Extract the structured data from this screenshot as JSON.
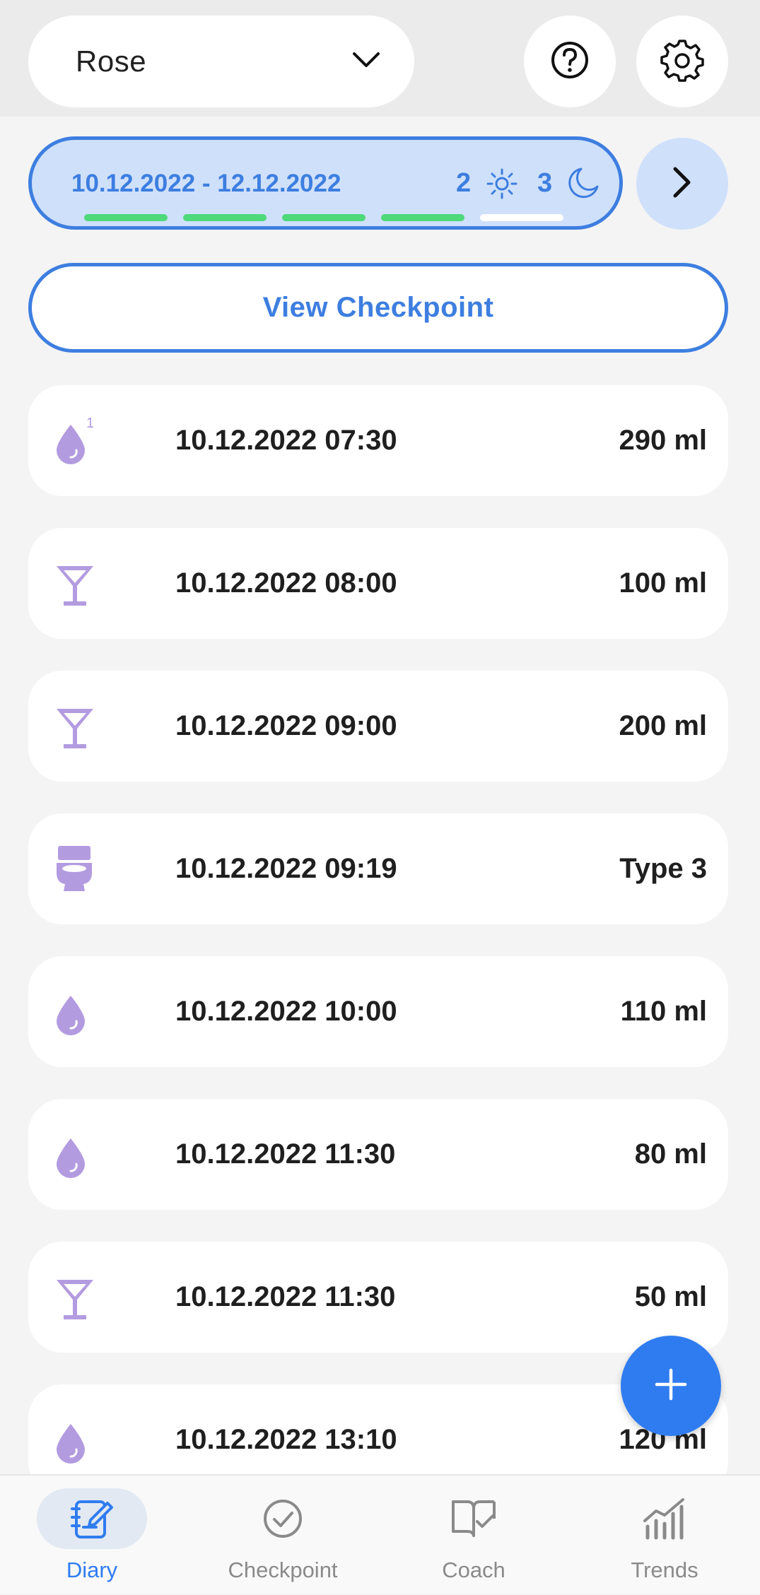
{
  "header": {
    "selected_item": "Rose",
    "help_icon": "help-circle-icon",
    "settings_icon": "gear-icon"
  },
  "period": {
    "range": "10.12.2022 - 12.12.2022",
    "day_count": "2",
    "night_count": "3",
    "progress_segments_filled": 4,
    "progress_segments_total": 5,
    "colors": {
      "accent": "#3d7ee0",
      "bg": "#cfe0fb",
      "filled": "#4ed97b"
    }
  },
  "view_checkpoint_label": "View Checkpoint",
  "entries": [
    {
      "icon": "drop-1-icon",
      "datetime": "10.12.2022 07:30",
      "value": "290 ml"
    },
    {
      "icon": "cocktail-glass-icon",
      "datetime": "10.12.2022 08:00",
      "value": "100 ml"
    },
    {
      "icon": "cocktail-glass-icon",
      "datetime": "10.12.2022 09:00",
      "value": "200 ml"
    },
    {
      "icon": "toilet-icon",
      "datetime": "10.12.2022 09:19",
      "value": "Type 3"
    },
    {
      "icon": "drop-icon",
      "datetime": "10.12.2022 10:00",
      "value": "110 ml"
    },
    {
      "icon": "drop-icon",
      "datetime": "10.12.2022 11:30",
      "value": "80 ml"
    },
    {
      "icon": "cocktail-glass-icon",
      "datetime": "10.12.2022 11:30",
      "value": "50 ml"
    },
    {
      "icon": "drop-icon",
      "datetime": "10.12.2022 13:10",
      "value": "120 ml"
    }
  ],
  "fab": {
    "icon": "plus-icon",
    "color": "#2f7cf0"
  },
  "nav": [
    {
      "label": "Diary",
      "icon": "diary-icon",
      "active": true
    },
    {
      "label": "Checkpoint",
      "icon": "check-circle-icon",
      "active": false
    },
    {
      "label": "Coach",
      "icon": "book-check-icon",
      "active": false
    },
    {
      "label": "Trends",
      "icon": "bar-chart-icon",
      "active": false
    }
  ],
  "icon_color": "#b39be0"
}
